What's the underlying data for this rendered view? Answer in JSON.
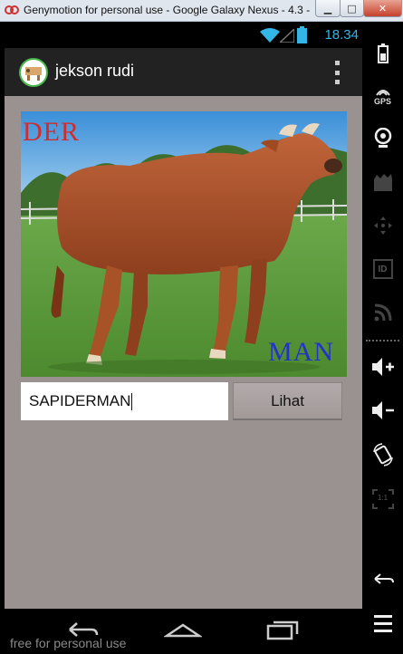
{
  "window": {
    "title": "Genymotion for personal use - Google Galaxy Nexus - 4.3 -",
    "minimize_glyph": "▁",
    "maximize_glyph": "□",
    "close_glyph": "✕"
  },
  "status_bar": {
    "time": "18.34"
  },
  "action_bar": {
    "title": "jekson rudi",
    "logo_icon": "app-logo-icon",
    "overflow_icon": "overflow-menu-icon"
  },
  "photo": {
    "top_text": "DER",
    "bottom_text": "MAN",
    "subject": "cow"
  },
  "form": {
    "input_value": "SAPIDERMAN",
    "button_label": "Lihat"
  },
  "nav_bar": {
    "back_icon": "back-icon",
    "home_icon": "home-icon",
    "recents_icon": "recents-icon"
  },
  "watermark": "free for personal use",
  "sidebar": {
    "gps_label": "GPS",
    "id_label": "ID",
    "ratio_label": "1:1"
  },
  "colors": {
    "content_bg": "#9a9191",
    "accent": "#33b5e5",
    "action_bar": "#222222"
  }
}
